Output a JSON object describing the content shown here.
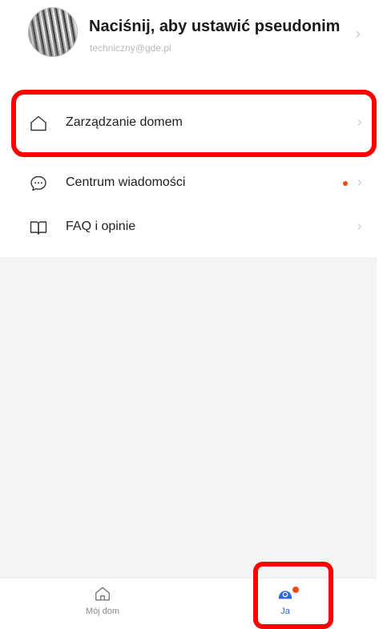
{
  "profile": {
    "nickname": "Naciśnij, aby ustawić pseudonim",
    "email": "techniczny@gde.pl",
    "chevron": "›"
  },
  "menu": {
    "items": [
      {
        "label": "Zarządzanie domem",
        "icon": "house-outline-icon",
        "chevron": "›",
        "highlighted": true
      },
      {
        "label": "Centrum wiadomości",
        "icon": "chat-bubble-icon",
        "chevron": "›",
        "has_unread_dot": true
      },
      {
        "label": "FAQ i opinie",
        "icon": "open-book-icon",
        "chevron": "›"
      }
    ]
  },
  "tabbar": {
    "tabs": [
      {
        "label": "Mój dom",
        "icon": "house-outline-icon",
        "active": false
      },
      {
        "label": "Ja",
        "icon": "person-icon",
        "active": true,
        "badge": true
      }
    ]
  },
  "colors": {
    "highlight_border": "#ff0000",
    "unread_dot": "#f04a1a",
    "active_tab": "#2f6ad8",
    "empty_area": "#f4f4f4"
  }
}
